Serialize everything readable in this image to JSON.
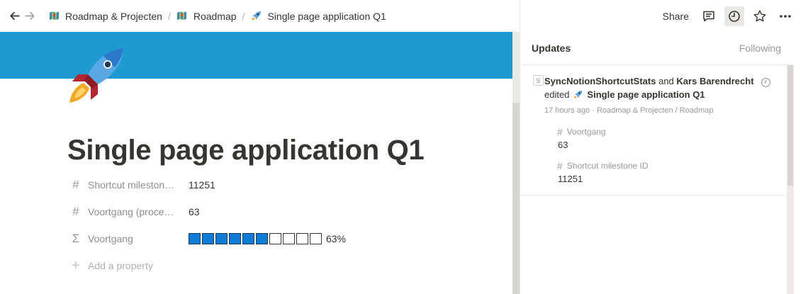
{
  "nav": {
    "back_icon": "arrow-left-icon",
    "forward_icon": "arrow-right-icon"
  },
  "breadcrumbs": [
    {
      "label": "Roadmap & Projecten",
      "icon": "map-icon"
    },
    {
      "label": "Roadmap",
      "icon": "map-icon"
    },
    {
      "label": "Single page application Q1",
      "icon": "rocket-icon"
    }
  ],
  "breadcrumb_separator": "/",
  "toolbar": {
    "share_label": "Share",
    "icons": [
      "comment-icon",
      "clock-icon",
      "star-icon",
      "more-icon"
    ]
  },
  "page": {
    "cover_color": "#1e9ad0",
    "icon": "rocket-icon",
    "title": "Single page application Q1",
    "properties": [
      {
        "icon": "#",
        "name": "Shortcut mileston…",
        "value": "11251"
      },
      {
        "icon": "#",
        "name": "Voortgang (proce…",
        "value": "63"
      },
      {
        "icon": "Σ",
        "name": "Voortgang",
        "progress_cells_filled": 6,
        "progress_cells_total": 10,
        "progress_label": "63%"
      }
    ],
    "add_property_label": "Add a property"
  },
  "updates_panel": {
    "header_title": "Updates",
    "header_following": "Following",
    "update": {
      "avatar_letter": "S",
      "actor1": "SyncNotionShortcutStats",
      "and_word": "and",
      "actor2": "Kars Barendrecht",
      "verb": "edited",
      "page_title": "Single page application Q1",
      "meta": "17 hours ago · Roadmap & Projecten / Roadmap",
      "changes": [
        {
          "icon": "#",
          "name": "Voortgang",
          "value": "63"
        },
        {
          "icon": "#",
          "name": "Shortcut milestone ID",
          "value": "11251"
        }
      ]
    }
  },
  "colors": {
    "accent": "#0f7bd5",
    "cover": "#1e9ad0",
    "text": "#37352f",
    "muted": "#9b9a97"
  }
}
